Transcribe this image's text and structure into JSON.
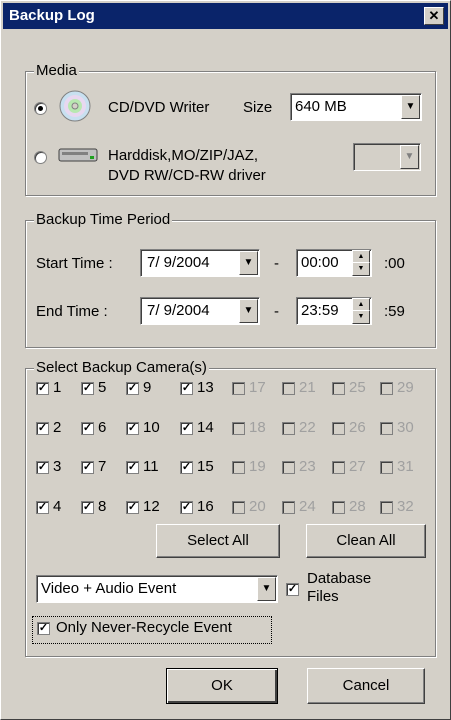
{
  "window": {
    "title": "Backup Log",
    "close_glyph": "✕"
  },
  "media": {
    "group_label": "Media",
    "option1": {
      "selected": true,
      "label": "CD/DVD Writer",
      "size_label": "Size",
      "size_value": "640 MB",
      "icon": "cd-dvd-icon"
    },
    "option2": {
      "selected": false,
      "label_line1": "Harddisk,MO/ZIP/JAZ,",
      "label_line2": "DVD RW/CD-RW driver",
      "drive_value": "",
      "icon": "harddisk-icon"
    }
  },
  "time_period": {
    "group_label": "Backup Time Period",
    "start_label": "Start Time :",
    "start_date": "7/ 9/2004",
    "start_time": "00:00",
    "start_seconds": ":00",
    "end_label": "End Time :",
    "end_date": "7/ 9/2004",
    "end_time": "23:59",
    "end_seconds": ":59",
    "separator": "-"
  },
  "cameras": {
    "group_label": "Select Backup Camera(s)",
    "rows": [
      [
        {
          "n": "1",
          "on": true
        },
        {
          "n": "5",
          "on": true
        },
        {
          "n": "9",
          "on": true
        },
        {
          "n": "13",
          "on": true
        },
        {
          "n": "17",
          "on": false
        },
        {
          "n": "21",
          "on": false
        },
        {
          "n": "25",
          "on": false
        },
        {
          "n": "29",
          "on": false
        }
      ],
      [
        {
          "n": "2",
          "on": true
        },
        {
          "n": "6",
          "on": true
        },
        {
          "n": "10",
          "on": true
        },
        {
          "n": "14",
          "on": true
        },
        {
          "n": "18",
          "on": false
        },
        {
          "n": "22",
          "on": false
        },
        {
          "n": "26",
          "on": false
        },
        {
          "n": "30",
          "on": false
        }
      ],
      [
        {
          "n": "3",
          "on": true
        },
        {
          "n": "7",
          "on": true
        },
        {
          "n": "11",
          "on": true
        },
        {
          "n": "15",
          "on": true
        },
        {
          "n": "19",
          "on": false
        },
        {
          "n": "23",
          "on": false
        },
        {
          "n": "27",
          "on": false
        },
        {
          "n": "31",
          "on": false
        }
      ],
      [
        {
          "n": "4",
          "on": true
        },
        {
          "n": "8",
          "on": true
        },
        {
          "n": "12",
          "on": true
        },
        {
          "n": "16",
          "on": true
        },
        {
          "n": "20",
          "on": false
        },
        {
          "n": "24",
          "on": false
        },
        {
          "n": "28",
          "on": false
        },
        {
          "n": "32",
          "on": false
        }
      ]
    ],
    "select_all_label": "Select All",
    "clean_all_label": "Clean All",
    "event_type_value": "Video + Audio Event",
    "database_files": {
      "checked": true,
      "label_line1": "Database",
      "label_line2": "Files"
    },
    "never_recycle": {
      "checked": true,
      "label": "Only Never-Recycle Event"
    }
  },
  "footer": {
    "ok_label": "OK",
    "cancel_label": "Cancel"
  },
  "glyphs": {
    "check": "✓",
    "down": "▼",
    "up_small": "▲",
    "down_small": "▼"
  }
}
